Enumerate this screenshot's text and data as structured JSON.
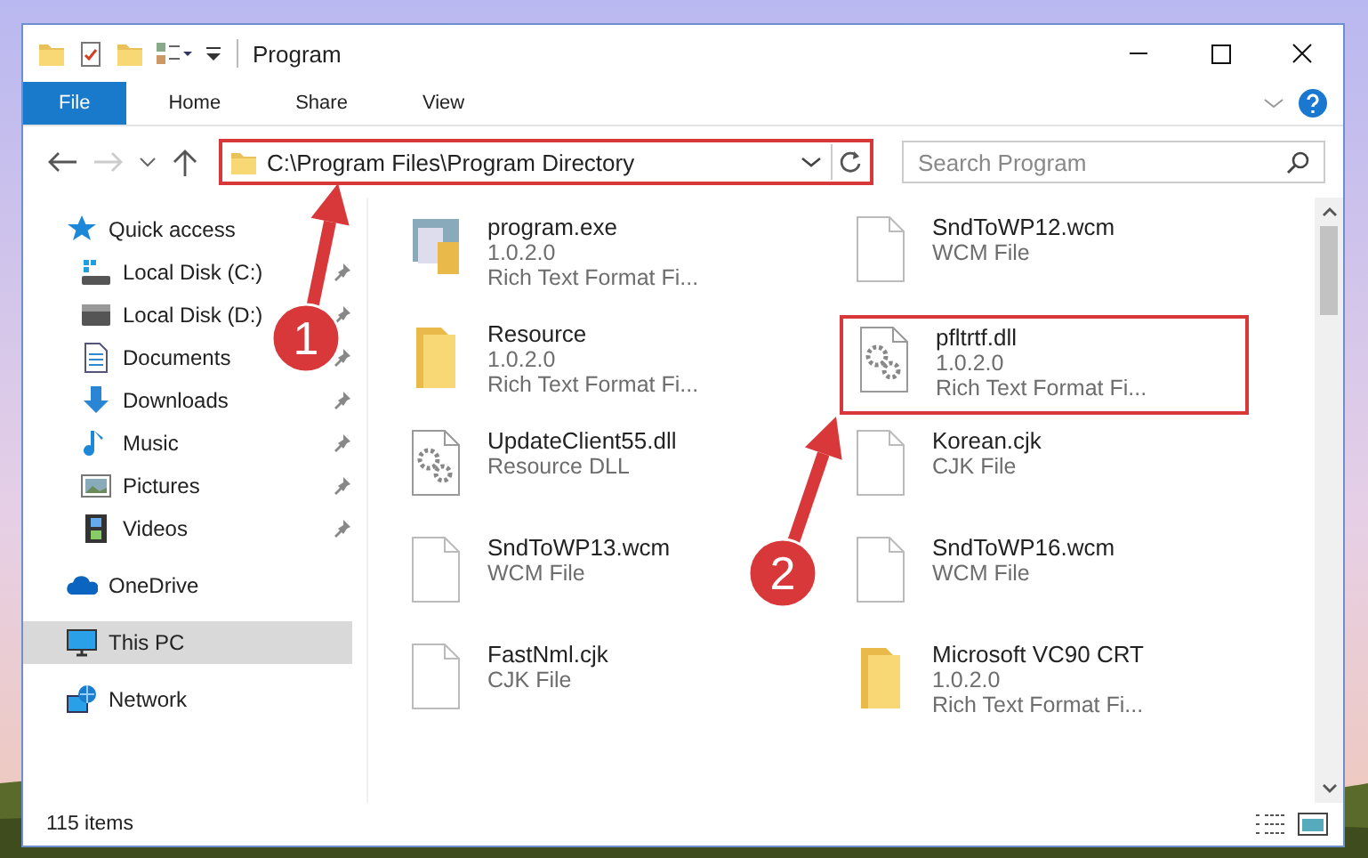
{
  "window": {
    "title": "Program"
  },
  "ribbon_tabs": [
    {
      "label": "File",
      "selected": true
    },
    {
      "label": "Home",
      "selected": false
    },
    {
      "label": "Share",
      "selected": false
    },
    {
      "label": "View",
      "selected": false
    }
  ],
  "address_bar": {
    "value": "C:\\Program Files\\Program Directory",
    "highlighted": true
  },
  "search": {
    "placeholder": "Search Program"
  },
  "sidebar": {
    "items": [
      {
        "label": "Quick access",
        "selected": false,
        "children": [
          {
            "label": "Local Disk (C:)",
            "pinned": true,
            "selected": false
          },
          {
            "label": "Local Disk (D:)",
            "pinned": true,
            "selected": false
          },
          {
            "label": "Documents",
            "pinned": true,
            "selected": false
          },
          {
            "label": "Downloads",
            "pinned": true,
            "selected": false
          },
          {
            "label": "Music",
            "pinned": true,
            "selected": false
          },
          {
            "label": "Pictures",
            "pinned": true,
            "selected": false
          },
          {
            "label": "Videos",
            "pinned": true,
            "selected": false
          }
        ]
      },
      {
        "label": "OneDrive",
        "selected": false
      },
      {
        "label": "This PC",
        "selected": true
      },
      {
        "label": "Network",
        "selected": false
      }
    ]
  },
  "files": [
    {
      "name": "program.exe",
      "details": [
        "1.0.2.0",
        "Rich Text Format Fi..."
      ],
      "kind": "exe",
      "highlighted": false
    },
    {
      "name": "SndToWP12.wcm",
      "details": [
        "WCM File"
      ],
      "kind": "file",
      "highlighted": false
    },
    {
      "name": "Resource",
      "details": [
        "1.0.2.0",
        "Rich Text Format Fi..."
      ],
      "kind": "folder",
      "highlighted": false
    },
    {
      "name": "pfltrtf.dll",
      "details": [
        "1.0.2.0",
        "Rich Text Format Fi..."
      ],
      "kind": "dll",
      "highlighted": true
    },
    {
      "name": "UpdateClient55.dll",
      "details": [
        "Resource DLL"
      ],
      "kind": "dll",
      "highlighted": false
    },
    {
      "name": "Korean.cjk",
      "details": [
        "CJK File"
      ],
      "kind": "file",
      "highlighted": false
    },
    {
      "name": "SndToWP13.wcm",
      "details": [
        "WCM File"
      ],
      "kind": "file",
      "highlighted": false
    },
    {
      "name": "SndToWP16.wcm",
      "details": [
        "WCM File"
      ],
      "kind": "file",
      "highlighted": false
    },
    {
      "name": "FastNml.cjk",
      "details": [
        "CJK File"
      ],
      "kind": "file",
      "highlighted": false
    },
    {
      "name": "Microsoft VC90 CRT",
      "details": [
        "1.0.2.0",
        "Rich Text Format Fi..."
      ],
      "kind": "folder",
      "highlighted": false
    }
  ],
  "status_bar": {
    "count": "115 items"
  },
  "callouts": [
    {
      "number": "1"
    },
    {
      "number": "2"
    }
  ]
}
